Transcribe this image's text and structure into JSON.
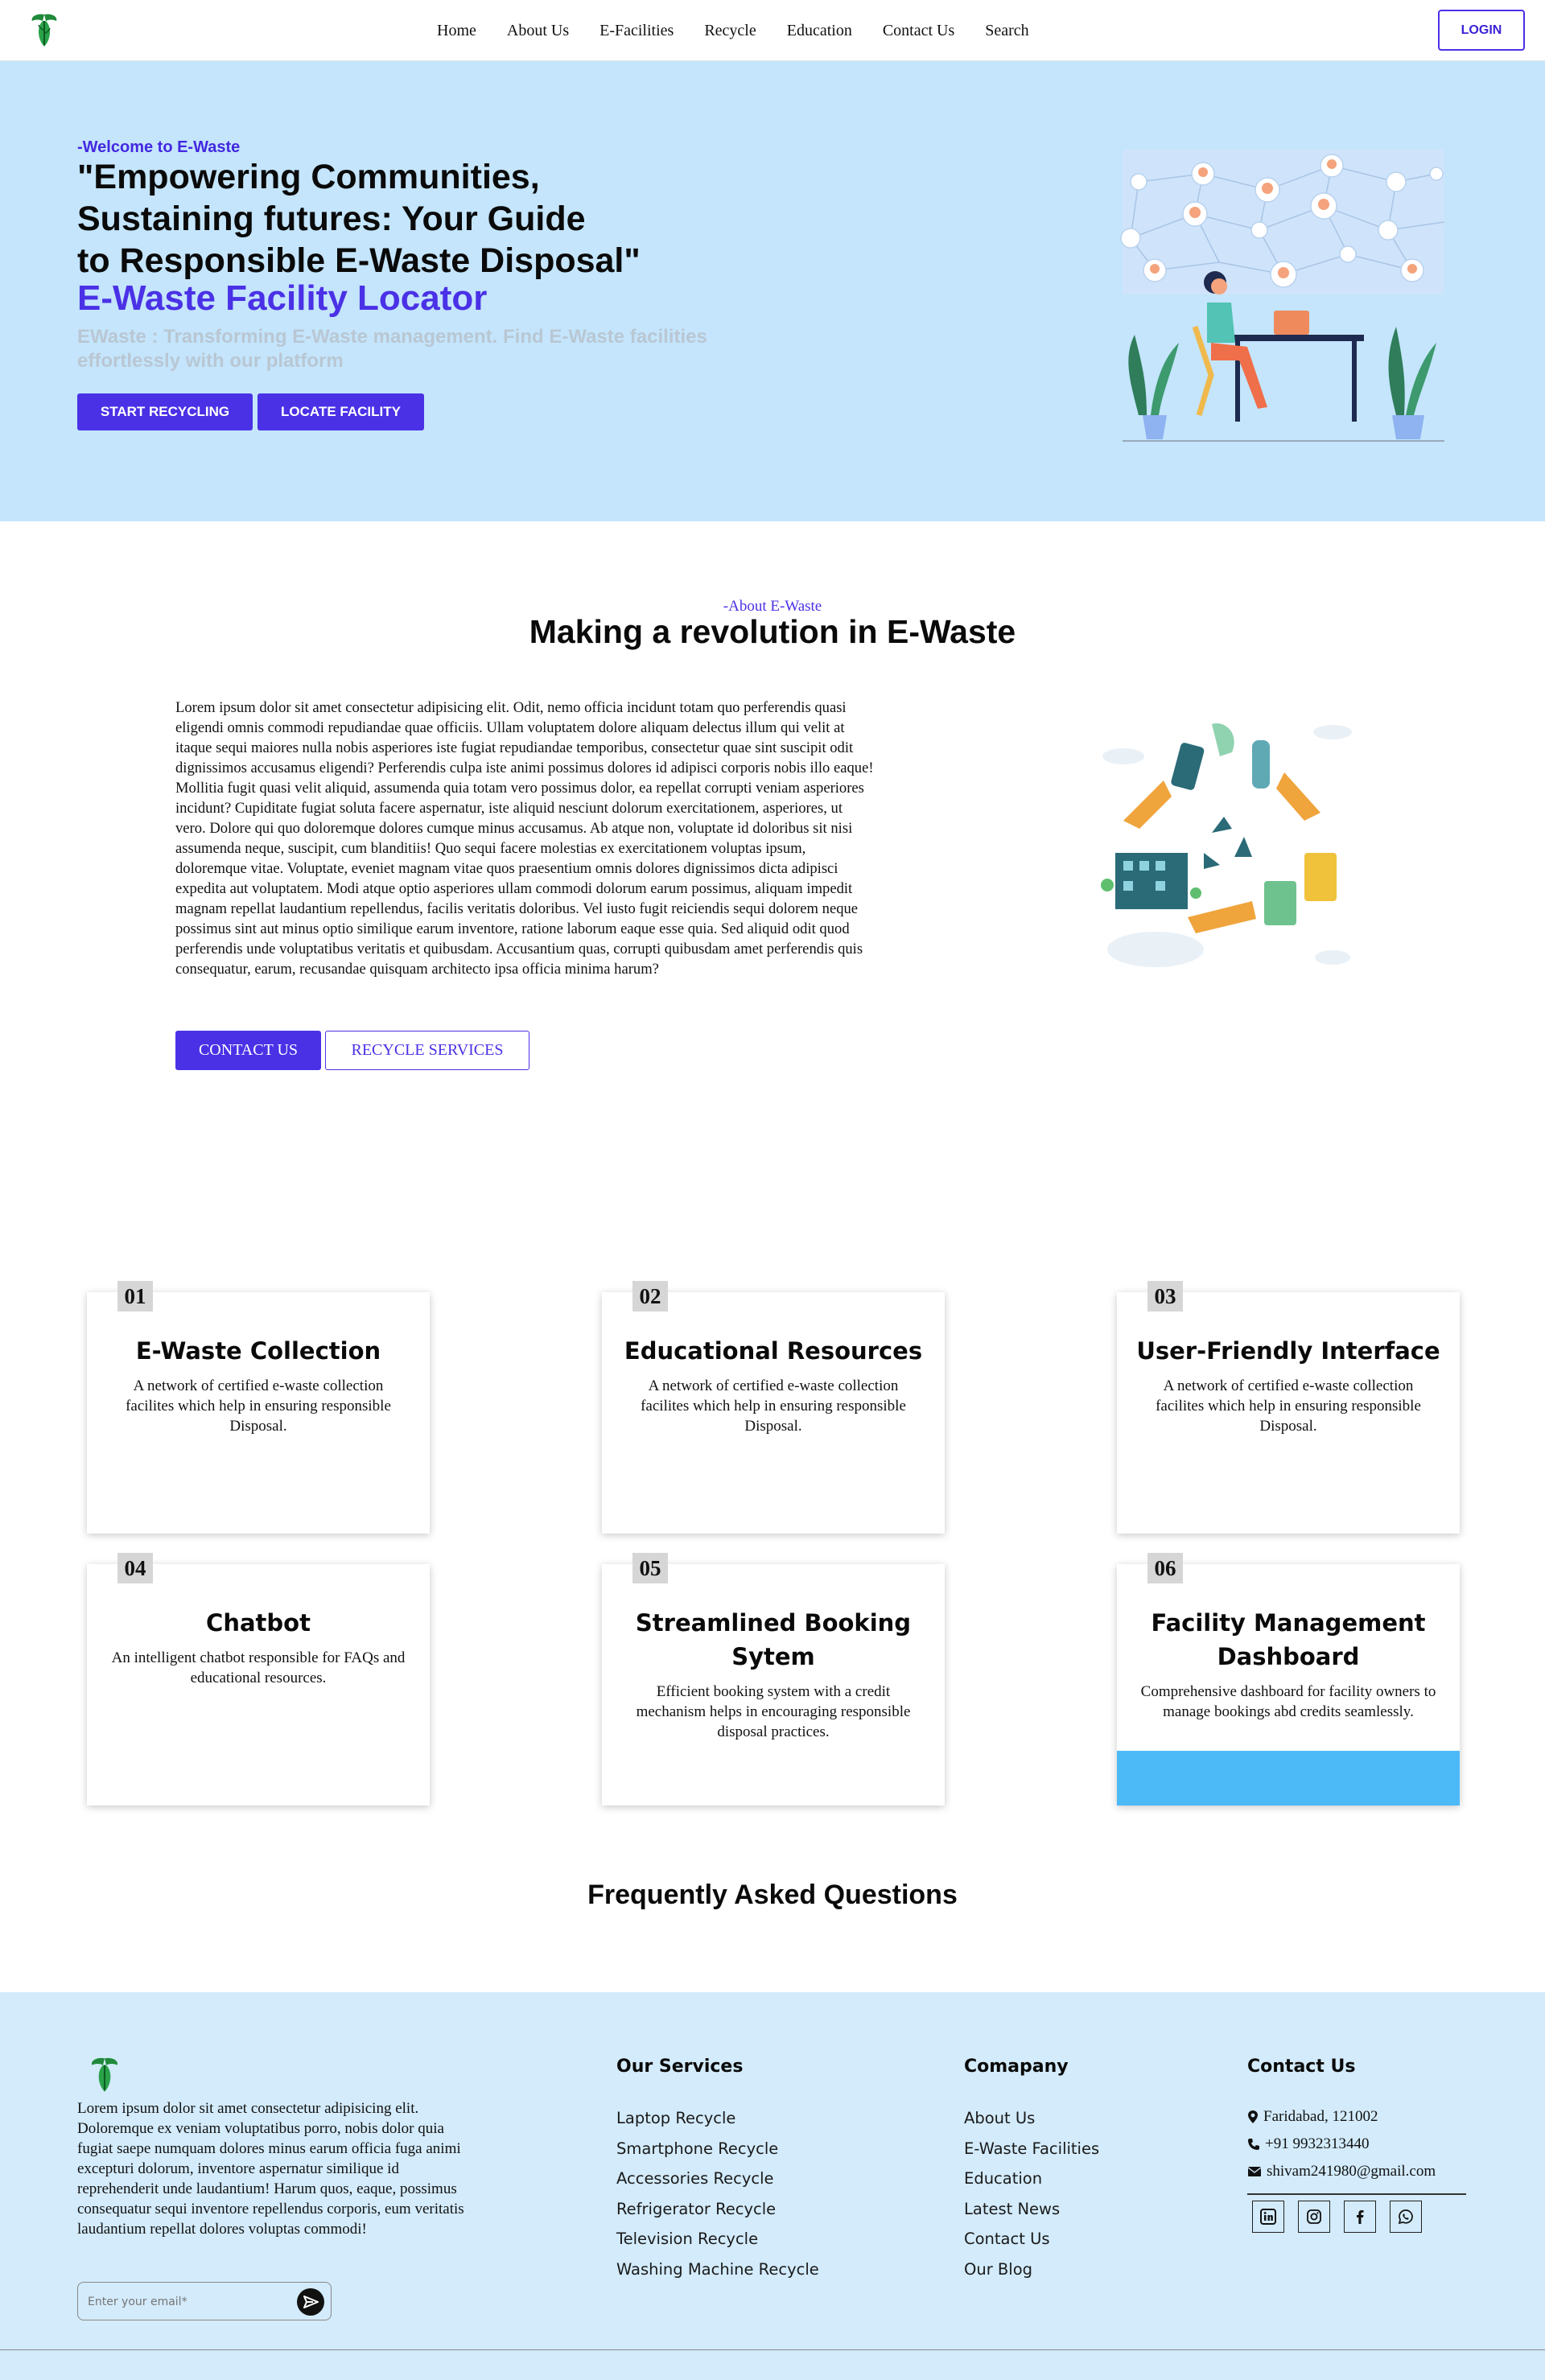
{
  "nav": {
    "items": [
      "Home",
      "About Us",
      "E-Facilities",
      "Recycle",
      "Education",
      "Contact Us",
      "Search"
    ],
    "login_label": "LOGIN",
    "logo_icon": "ewaste-logo-icon"
  },
  "hero": {
    "kicker": "-Welcome to E-Waste",
    "headline_lines": [
      "\"Empowering Communities,",
      "Sustaining futures: Your Guide",
      "to Responsible E-Waste Disposal\""
    ],
    "locator_title": "E-Waste Facility Locator",
    "subtitle_lines": [
      "EWaste : Transforming E-Waste management. Find E-Waste facilities",
      "effortlessly with our platform"
    ],
    "buttons": [
      "START RECYCLING",
      "LOCATE FACILITY"
    ],
    "illustration_icon": "network-people-illustration-icon"
  },
  "about": {
    "kicker": "-About E-Waste",
    "title": "Making a revolution in E-Waste",
    "text": "Lorem ipsum dolor sit amet consectetur adipisicing elit. Odit, nemo officia incidunt totam quo perferendis quasi eligendi omnis commodi repudiandae quae officiis. Ullam voluptatem dolore aliquam delectus illum qui velit at itaque sequi maiores nulla nobis asperiores iste fugiat repudiandae temporibus, consectetur quae sint suscipit odit dignissimos accusamus eligendi? Perferendis culpa iste animi possimus dolores id adipisci corporis nobis illo eaque! Mollitia fugit quasi velit aliquid, assumenda quia totam vero possimus dolor, ea repellat corrupti veniam asperiores incidunt? Cupiditate fugiat soluta facere aspernatur, iste aliquid nesciunt dolorum exercitationem, asperiores, ut vero. Dolore qui quo doloremque dolores cumque minus accusamus. Ab atque non, voluptate id doloribus sit nisi assumenda neque, suscipit, cum blanditiis! Quo sequi facere molestias ex exercitationem voluptas ipsum, doloremque vitae. Voluptate, eveniet magnam vitae quos praesentium omnis dolores dignissimos dicta adipisci expedita aut voluptatem. Modi atque optio asperiores ullam commodi dolorum earum possimus, aliquam impedit magnam repellat laudantium repellendus, facilis veritatis doloribus. Vel iusto fugit reiciendis sequi dolorem neque possimus sint aut minus optio similique earum inventore, ratione laborum eaque esse quia. Sed aliquid odit quod perferendis unde voluptatibus veritatis et quibusdam. Accusantium quas, corrupti quibusdam amet perferendis quis consequatur, earum, recusandae quisquam architecto ipsa officia minima harum?",
    "buttons": [
      "CONTACT US",
      "RECYCLE SERVICES"
    ],
    "illustration_icon": "recycle-cycle-illustration-icon"
  },
  "features": [
    {
      "num": "01",
      "title": "E-Waste Collection",
      "desc": "A network of certified e-waste collection facilites which help in ensuring responsible Disposal."
    },
    {
      "num": "02",
      "title": "Educational Resources",
      "desc": "A network of certified e-waste collection facilites which help in ensuring responsible Disposal."
    },
    {
      "num": "03",
      "title": "User-Friendly Interface",
      "desc": "A network of certified e-waste collection facilites which help in ensuring responsible Disposal."
    },
    {
      "num": "04",
      "title": "Chatbot",
      "desc": "An intelligent chatbot responsible for FAQs and educational resources."
    },
    {
      "num": "05",
      "title": "Streamlined Booking Sytem",
      "desc": "Efficient booking system with a credit mechanism helps in encouraging responsible disposal practices."
    },
    {
      "num": "06",
      "title": "Facility Management Dashboard",
      "desc": "Comprehensive dashboard for facility owners to manage bookings abd credits seamlessly."
    }
  ],
  "faq": {
    "title": "Frequently Asked Questions"
  },
  "footer": {
    "about_text": "Lorem ipsum dolor sit amet consectetur adipisicing elit. Doloremque ex veniam voluptatibus porro, nobis dolor quia fugiat saepe numquam dolores minus earum officia fuga animi excepturi dolorum, inventore aspernatur similique id reprehenderit unde laudantium! Harum quos, eaque, possimus consequatur sequi inventore repellendus corporis, eum veritatis laudantium repellat dolores voluptas commodi!",
    "email_placeholder": "Enter your email*",
    "services_title": "Our Services",
    "services": [
      "Laptop Recycle",
      "Smartphone Recycle",
      "Accessories Recycle",
      "Refrigerator Recycle",
      "Television Recycle",
      "Washing Machine Recycle"
    ],
    "company_title": "Comapany",
    "company": [
      "About Us",
      "E-Waste Facilities",
      "Education",
      "Latest News",
      "Contact Us",
      "Our Blog"
    ],
    "contact_title": "Contact Us",
    "address": "Faridabad, 121002",
    "phone": "+91 9932313440",
    "email": "shivam241980@gmail.com",
    "socials": [
      "linkedin-icon",
      "instagram-icon",
      "facebook-icon",
      "whatsapp-icon"
    ]
  },
  "colors": {
    "accent": "#4a31e6",
    "hero_bg": "#c4e5fc",
    "footer_bg": "#d3ebfb",
    "card_bar": "#4dbaf8"
  }
}
